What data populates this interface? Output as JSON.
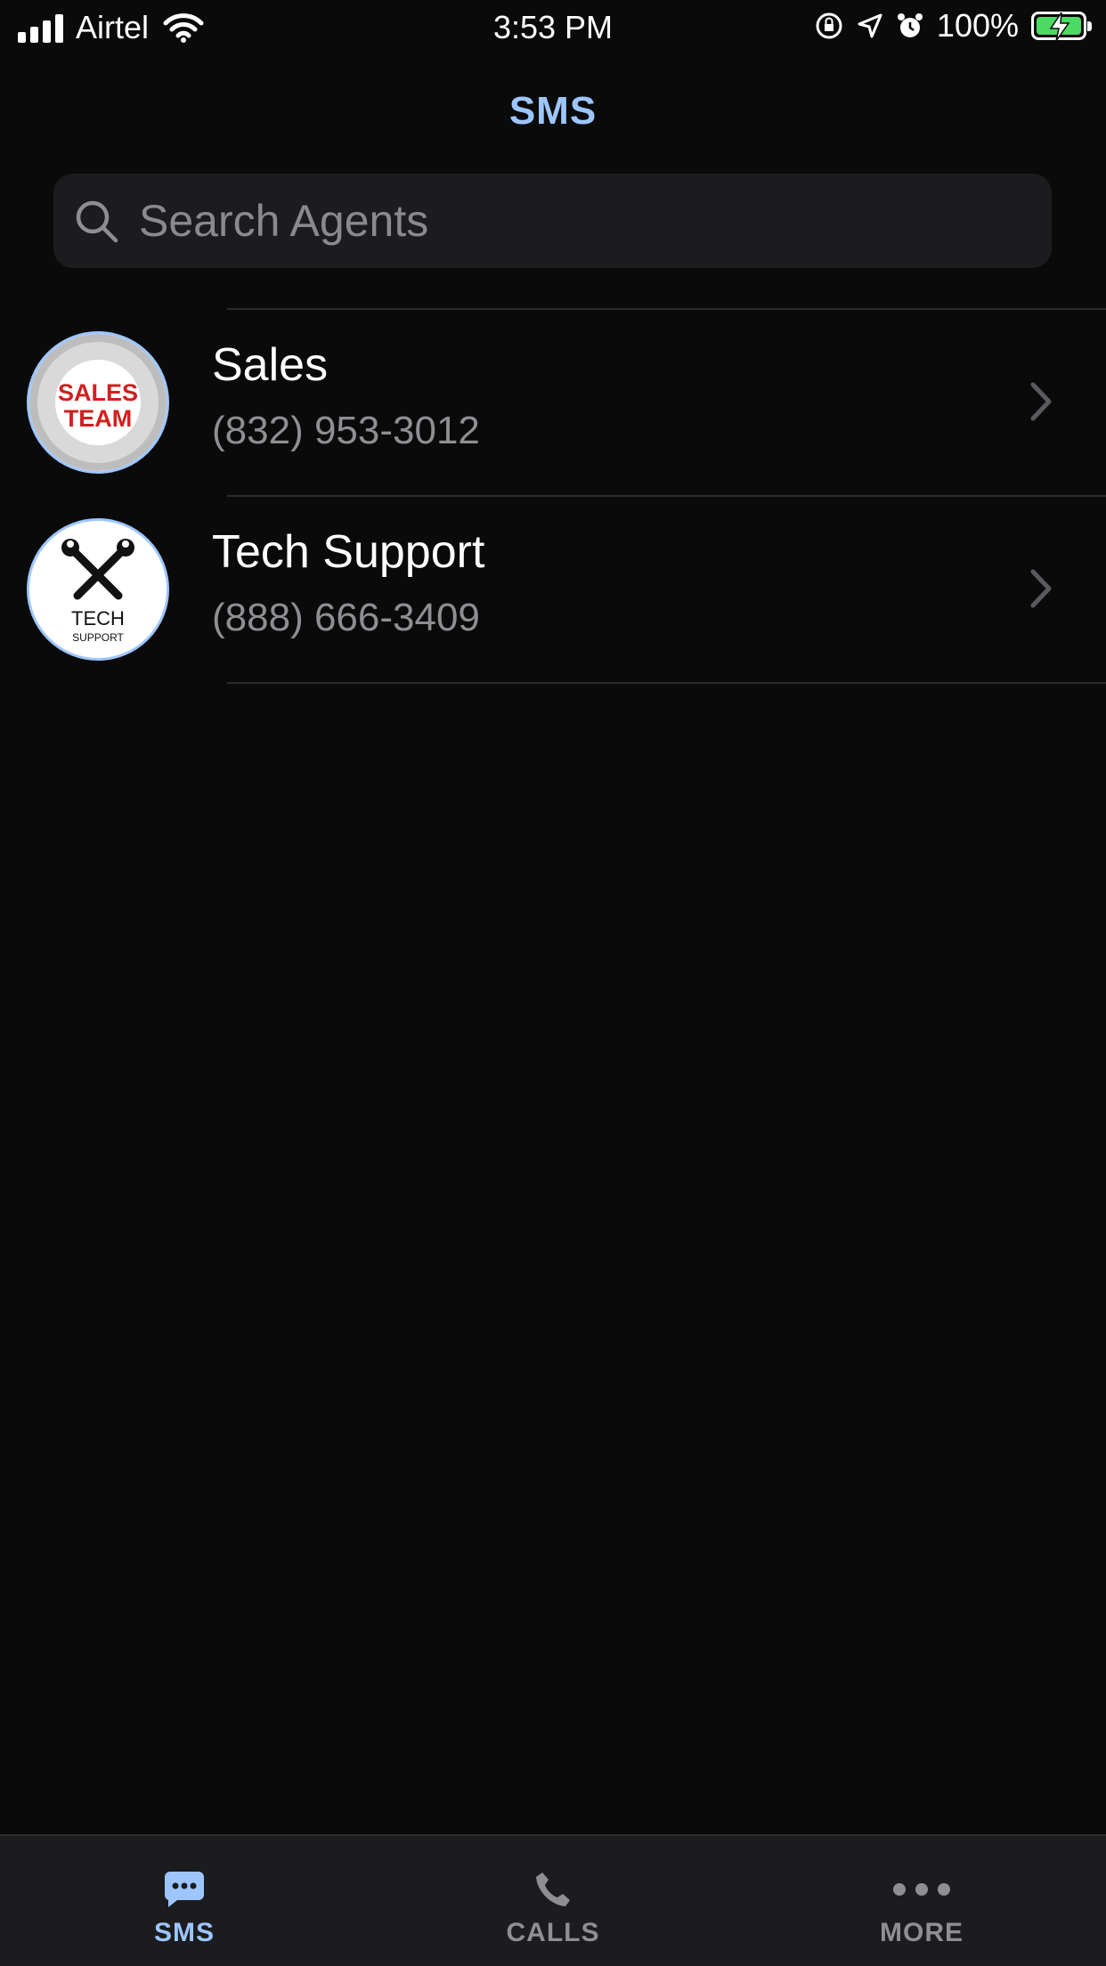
{
  "status_bar": {
    "carrier": "Airtel",
    "time": "3:53 PM",
    "battery_percent": "100%",
    "icons": [
      "signal-icon",
      "wifi-icon",
      "orientation-lock-icon",
      "location-icon",
      "alarm-icon",
      "battery-charging-icon"
    ]
  },
  "header": {
    "title": "SMS"
  },
  "search": {
    "placeholder": "Search Agents",
    "value": ""
  },
  "agents": [
    {
      "name": "Sales",
      "phone": "(832) 953-3012",
      "avatar_text": [
        "SALES",
        "TEAM"
      ]
    },
    {
      "name": "Tech Support",
      "phone": "(888) 666-3409",
      "avatar_text": [
        "TECH",
        "SUPPORT"
      ]
    }
  ],
  "tabs": [
    {
      "label": "SMS",
      "icon": "message-bubble-icon",
      "active": true
    },
    {
      "label": "CALLS",
      "icon": "phone-icon",
      "active": false
    },
    {
      "label": "MORE",
      "icon": "more-dots-icon",
      "active": false
    }
  ],
  "colors": {
    "accent": "#9dc6ff",
    "background": "#0a0a0b",
    "surface": "#1c1c1e",
    "secondary_text": "#8e8e93",
    "battery": "#4cd964"
  }
}
